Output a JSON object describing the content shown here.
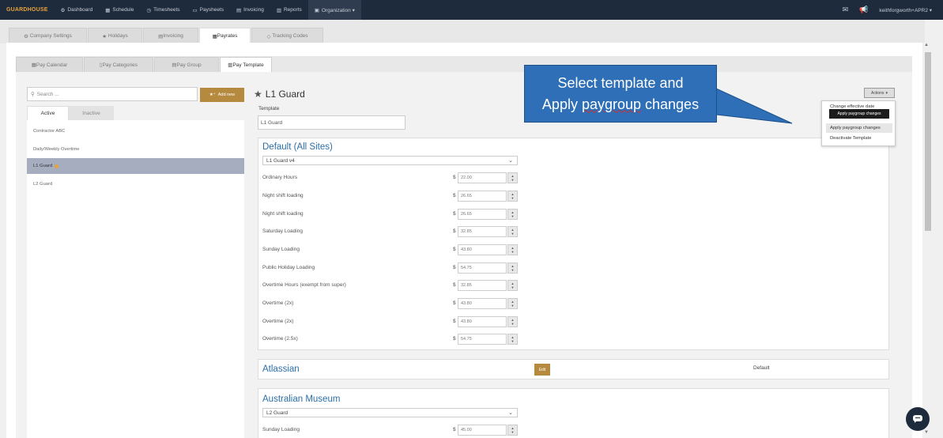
{
  "topnav": {
    "brand": "GUARDHOUSE",
    "items": [
      {
        "icon": "dashboard-icon",
        "glyph": "⚙",
        "label": "Dashboard"
      },
      {
        "icon": "calendar-icon",
        "glyph": "▦",
        "label": "Schedule"
      },
      {
        "icon": "clock-icon",
        "glyph": "◷",
        "label": "Timesheets"
      },
      {
        "icon": "money-icon",
        "glyph": "▭",
        "label": "Paysheets"
      },
      {
        "icon": "invoice-icon",
        "glyph": "▤",
        "label": "Invoicing"
      },
      {
        "icon": "reports-icon",
        "glyph": "▥",
        "label": "Reports"
      },
      {
        "icon": "building-icon",
        "glyph": "▣",
        "label": "Organization ▾"
      }
    ],
    "user": "keithforgworth+APR2 ▾"
  },
  "tabs1": [
    {
      "icon": "gear-icon",
      "glyph": "⚙",
      "label": "Company Settings"
    },
    {
      "icon": "star-icon",
      "glyph": "★",
      "label": "Holidays"
    },
    {
      "icon": "invoice-icon",
      "glyph": "▤",
      "label": "Invoicing"
    },
    {
      "icon": "calendar-icon",
      "glyph": "▦",
      "label": "Payrates"
    },
    {
      "icon": "tag-icon",
      "glyph": "◇",
      "label": "Tracking Codes"
    }
  ],
  "tabs2": [
    {
      "icon": "calendar-icon",
      "glyph": "▦",
      "label": "Pay Calendar"
    },
    {
      "icon": "file-icon",
      "glyph": "▯",
      "label": "Pay Categories"
    },
    {
      "icon": "group-icon",
      "glyph": "▤",
      "label": "Pay Group"
    },
    {
      "icon": "bank-icon",
      "glyph": "▥",
      "label": "Pay Template"
    }
  ],
  "left": {
    "search_placeholder": "Search ...",
    "add_new": "Add new",
    "tab_active": "Active",
    "tab_inactive": "Inactive",
    "items": [
      "Contractor ABC",
      "Daily/Weekly Overtime",
      "L1 Guard",
      "L2 Guard"
    ]
  },
  "template": {
    "title": "L1 Guard",
    "label": "Template",
    "value": "L1 Guard"
  },
  "default_card": {
    "title": "Default (All Sites)",
    "select": "L1 Guard v4",
    "rows": [
      {
        "label": "Ordinary Hours",
        "value": "22.00"
      },
      {
        "label": "Night shift loading",
        "value": "26.65"
      },
      {
        "label": "Night shift loading",
        "value": "26.65"
      },
      {
        "label": "Saturday Loading",
        "value": "32.85"
      },
      {
        "label": "Sunday Loading",
        "value": "43.80"
      },
      {
        "label": "Public Holiday Loading",
        "value": "54.75"
      },
      {
        "label": "Overtime Hours (exempt from super)",
        "value": "32.85"
      },
      {
        "label": "Overtime (2x)",
        "value": "43.80"
      },
      {
        "label": "Overtime (2x)",
        "value": "43.80"
      },
      {
        "label": "Overtime (2.5x)",
        "value": "54.75"
      }
    ],
    "currency": "$"
  },
  "atlassian_card": {
    "title": "Atlassian",
    "edit": "Edit",
    "default": "Default"
  },
  "museum_card": {
    "title": "Australian Museum",
    "select": "L2 Guard",
    "row": {
      "label": "Sunday Loading",
      "value": "45.00"
    }
  },
  "callout": {
    "line1": "Select template and",
    "line2a": "Apply ",
    "line2b": "paygroup",
    "line2c": " changes"
  },
  "actions": {
    "button": "Actions",
    "menu": [
      "Change effective date",
      "Apply paygroup changes",
      "Deactivate Template"
    ],
    "tooltip": "Apply paygroup changes"
  }
}
